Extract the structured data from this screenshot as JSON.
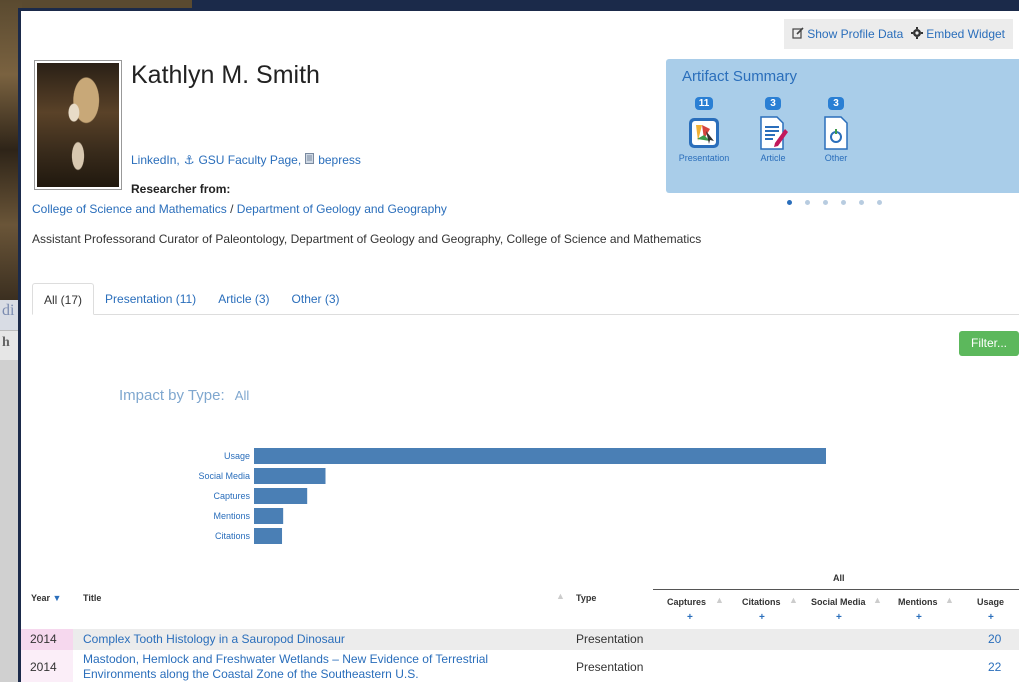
{
  "background": {
    "left_text": "di",
    "left_text2": "h"
  },
  "topbar": {
    "show_profile": "Show Profile Data",
    "embed_widget": "Embed Widget"
  },
  "profile": {
    "name": "Kathlyn M. Smith",
    "links": [
      "LinkedIn,",
      "GSU Faculty Page,",
      "bepress"
    ],
    "researcher_label": "Researcher from:",
    "college": "College of Science and Mathematics",
    "dept_sep": " / ",
    "department": "Department of Geology and Geography",
    "position": "Assistant Professorand Curator of Paleontology, Department of Geology and Geography, College of Science and Mathematics"
  },
  "summary": {
    "title": "Artifact Summary",
    "items": [
      {
        "count": "11",
        "label": "Presentation",
        "icon": "presentation-icon"
      },
      {
        "count": "3",
        "label": "Article",
        "icon": "article-icon"
      },
      {
        "count": "3",
        "label": "Other",
        "icon": "other-icon"
      }
    ]
  },
  "tabs": [
    "All (17)",
    "Presentation (11)",
    "Article (3)",
    "Other (3)"
  ],
  "filter_label": "Filter...",
  "impact": {
    "title": "Impact by Type:",
    "selected": "All"
  },
  "chart_data": {
    "type": "bar",
    "orientation": "horizontal",
    "categories": [
      "Usage",
      "Social Media",
      "Captures",
      "Mentions",
      "Citations"
    ],
    "values": [
      100,
      12.5,
      9.3,
      5.1,
      4.9
    ],
    "grid": false,
    "color": "#4a7fb5"
  },
  "table": {
    "headers": {
      "year": "Year",
      "title": "Title",
      "type": "Type",
      "group": "All",
      "captures": "Captures",
      "citations": "Citations",
      "social": "Social Media",
      "mentions": "Mentions",
      "usage": "Usage"
    },
    "rows": [
      {
        "year": "2014",
        "title": "Complex Tooth Histology in a Sauropod Dinosaur",
        "type": "Presentation",
        "usage": "20"
      },
      {
        "year": "2014",
        "title_line1": "Mastodon, Hemlock and Freshwater Wetlands – New Evidence of Terrestrial",
        "title_line2": "Environments along the Coastal Zone of the Southeastern U.S.",
        "type": "Presentation",
        "usage": "22"
      }
    ]
  }
}
